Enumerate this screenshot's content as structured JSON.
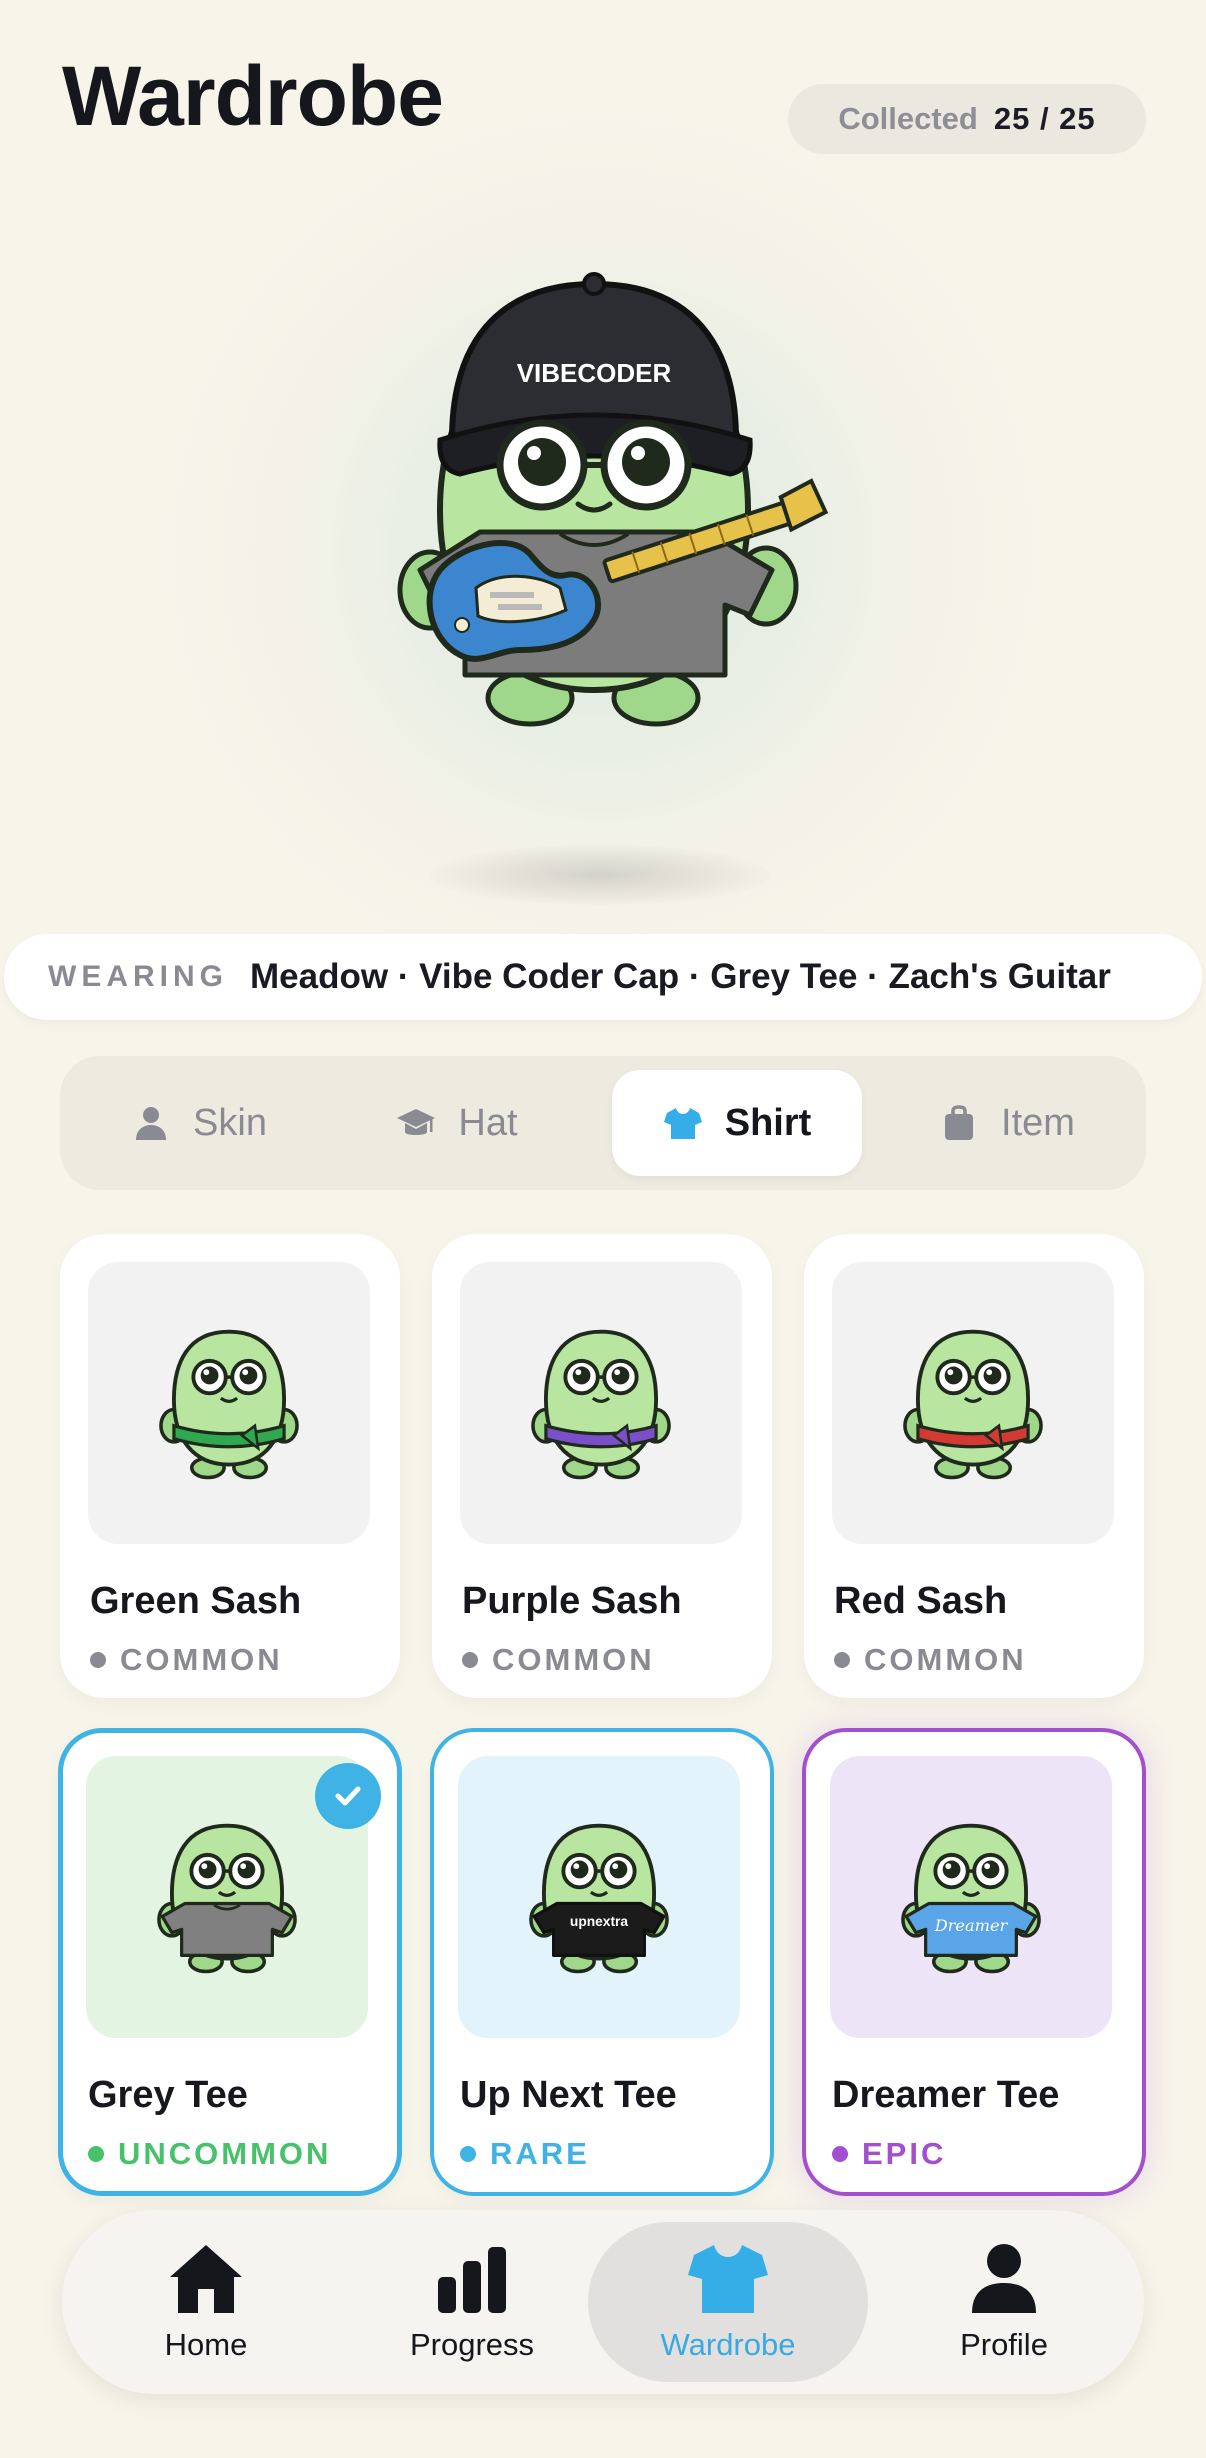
{
  "header": {
    "title": "Wardrobe",
    "collected_label": "Collected",
    "collected_value": "25 / 25"
  },
  "hero": {
    "cap_text": "VIBECODER"
  },
  "wearing": {
    "label": "WEARING",
    "items": "Meadow · Vibe Coder Cap · Grey Tee · Zach's Guitar"
  },
  "tabs": [
    {
      "label": "Skin",
      "icon": "person-icon"
    },
    {
      "label": "Hat",
      "icon": "graduation-cap-icon"
    },
    {
      "label": "Shirt",
      "icon": "tshirt-icon",
      "active": true
    },
    {
      "label": "Item",
      "icon": "bag-icon"
    }
  ],
  "items": [
    {
      "name": "Green Sash",
      "rarity": "COMMON",
      "accent": "#2fa84f"
    },
    {
      "name": "Purple Sash",
      "rarity": "COMMON",
      "accent": "#7b4fc9"
    },
    {
      "name": "Red Sash",
      "rarity": "COMMON",
      "accent": "#d23a33"
    },
    {
      "name": "Grey Tee",
      "rarity": "UNCOMMON",
      "accent": "#808080",
      "equipped": true
    },
    {
      "name": "Up Next Tee",
      "rarity": "RARE",
      "accent": "#1b1b1b",
      "shirt_text": "upnextra"
    },
    {
      "name": "Dreamer Tee",
      "rarity": "EPIC",
      "accent": "#5aa4e8",
      "shirt_text": "Dreamer"
    }
  ],
  "colors": {
    "background": "#f7f4ea",
    "accent_blue": "#3fb3e6",
    "common": "#8a8a93",
    "uncommon": "#48c26a",
    "rare": "#3fb3e6",
    "epic": "#a34fd0",
    "body_green": "#b8e6a0"
  },
  "nav": [
    {
      "label": "Home",
      "icon": "home-icon"
    },
    {
      "label": "Progress",
      "icon": "bar-chart-icon"
    },
    {
      "label": "Wardrobe",
      "icon": "tshirt-icon",
      "active": true
    },
    {
      "label": "Profile",
      "icon": "profile-icon"
    }
  ]
}
